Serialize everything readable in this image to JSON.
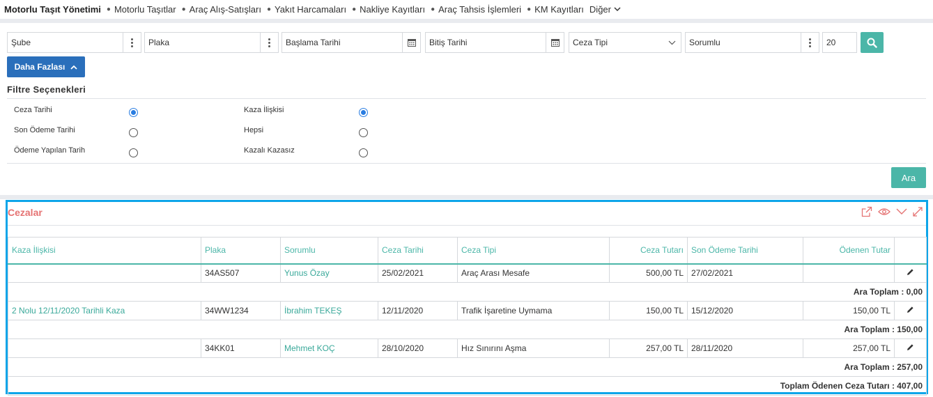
{
  "nav": {
    "title": "Motorlu Taşıt Yönetimi",
    "items": [
      {
        "label": "Motorlu Taşıtlar"
      },
      {
        "label": "Araç Alış-Satışları"
      },
      {
        "label": "Yakıt Harcamaları"
      },
      {
        "label": "Nakliye Kayıtları"
      },
      {
        "label": "Araç Tahsis İşlemleri"
      },
      {
        "label": "KM Kayıtları"
      }
    ],
    "more_label": "Diğer"
  },
  "filters": {
    "sube": "Şube",
    "plaka": "Plaka",
    "start_date": "Başlama Tarihi",
    "end_date": "Bitiş Tarihi",
    "ceza_tipi": "Ceza Tipi",
    "sorumlu": "Sorumlu",
    "page_size": "20",
    "more_button": "Daha Fazlası",
    "options_title": "Filtre Seçenekleri",
    "date_options": [
      {
        "label": "Ceza Tarihi",
        "selected": true
      },
      {
        "label": "Son Ödeme Tarihi",
        "selected": false
      },
      {
        "label": "Ödeme Yapılan Tarih",
        "selected": false
      }
    ],
    "accident_options": [
      {
        "label": "Kaza İlişkisi",
        "selected": true
      },
      {
        "label": "Hepsi",
        "selected": false
      },
      {
        "label": "Kazalı Kazasız",
        "selected": false
      }
    ],
    "search_button": "Ara"
  },
  "panel": {
    "title": "Cezalar",
    "columns": [
      "Kaza İlişkisi",
      "Plaka",
      "Sorumlu",
      "Ceza Tarihi",
      "Ceza Tipi",
      "Ceza Tutarı",
      "Son Ödeme Tarihi",
      "Ödenen Tutar"
    ],
    "rows": [
      {
        "kaza": "",
        "plaka": "34AS507",
        "sorumlu": "Yunus Özay",
        "ceza_tarihi": "25/02/2021",
        "ceza_tipi": "Araç Arası Mesafe",
        "tutar": "500,00 TL",
        "son_odeme": "27/02/2021",
        "odenen": "",
        "subtotal": "Ara Toplam : 0,00"
      },
      {
        "kaza": "2 Nolu 12/11/2020 Tarihli Kaza",
        "plaka": "34WW1234",
        "sorumlu": "İbrahim TEKEŞ",
        "ceza_tarihi": "12/11/2020",
        "ceza_tipi": "Trafik İşaretine Uymama",
        "tutar": "150,00 TL",
        "son_odeme": "15/12/2020",
        "odenen": "150,00 TL",
        "subtotal": "Ara Toplam : 150,00"
      },
      {
        "kaza": "",
        "plaka": "34KK01",
        "sorumlu": "Mehmet KOÇ",
        "ceza_tarihi": "28/10/2020",
        "ceza_tipi": "Hız Sınırını Aşma",
        "tutar": "257,00 TL",
        "son_odeme": "28/11/2020",
        "odenen": "257,00 TL",
        "subtotal": "Ara Toplam : 257,00"
      }
    ],
    "total": "Toplam Ödenen Ceza Tutarı : 407,00"
  },
  "colors": {
    "accent": "#4bb6a8",
    "primary": "#2a6fbb",
    "panel_border": "#0ea5e9",
    "panel_title": "#e57373"
  }
}
